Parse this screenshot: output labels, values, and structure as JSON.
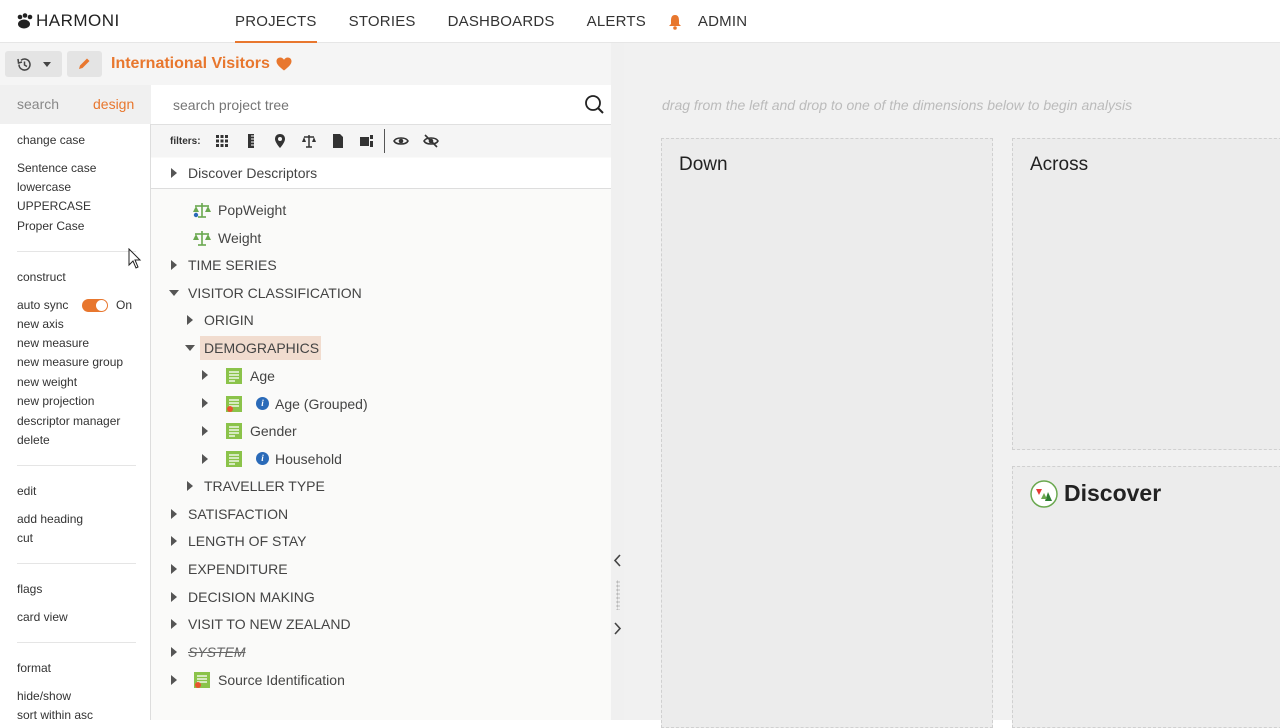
{
  "app": {
    "logo": "HARMONI"
  },
  "nav": {
    "items": [
      "PROJECTS",
      "STORIES",
      "DASHBOARDS",
      "ALERTS",
      "ADMIN"
    ],
    "active": "PROJECTS"
  },
  "project": {
    "title": "International Visitors"
  },
  "tabs": {
    "search": "search",
    "design": "design"
  },
  "sidebar": {
    "change_case": {
      "heading": "change case",
      "items": [
        "Sentence case",
        "lowercase",
        "UPPERCASE",
        "Proper Case"
      ]
    },
    "construct": {
      "heading": "construct",
      "auto_sync_label": "auto sync",
      "auto_sync_state": "On",
      "items": [
        "new axis",
        "new measure",
        "new measure group",
        "new weight",
        "new projection",
        "descriptor manager",
        "delete"
      ]
    },
    "edit": {
      "heading": "edit",
      "items": [
        "add heading",
        "cut"
      ]
    },
    "flags": {
      "heading": "flags",
      "items": [
        "card view"
      ]
    },
    "format": {
      "heading": "format",
      "items": [
        "hide/show",
        "sort within asc"
      ]
    }
  },
  "search": {
    "placeholder": "search project tree"
  },
  "filters": {
    "label": "filters:"
  },
  "tree": {
    "discover_descriptors": "Discover Descriptors",
    "popweight": "PopWeight",
    "weight": "Weight",
    "time_series": "TIME SERIES",
    "visitor_classification": "VISITOR CLASSIFICATION",
    "origin": "ORIGIN",
    "demographics": "DEMOGRAPHICS",
    "age": "Age",
    "age_grouped": "Age (Grouped)",
    "gender": "Gender",
    "household": "Household",
    "traveller_type": "TRAVELLER TYPE",
    "satisfaction": "SATISFACTION",
    "length_of_stay": "LENGTH OF STAY",
    "expenditure": "EXPENDITURE",
    "decision_making": "DECISION MAKING",
    "visit_nz": "VISIT TO NEW ZEALAND",
    "system": "SYSTEM",
    "source_identification": "Source Identification"
  },
  "canvas": {
    "hint": "drag from the left and drop to one of the dimensions below to begin analysis",
    "down": "Down",
    "across": "Across",
    "discover": "Discover"
  },
  "colors": {
    "accent": "#e8772e",
    "link": "#2a6ab8",
    "highlight": "#f1dccf",
    "doc_green": "#8bc34a"
  }
}
